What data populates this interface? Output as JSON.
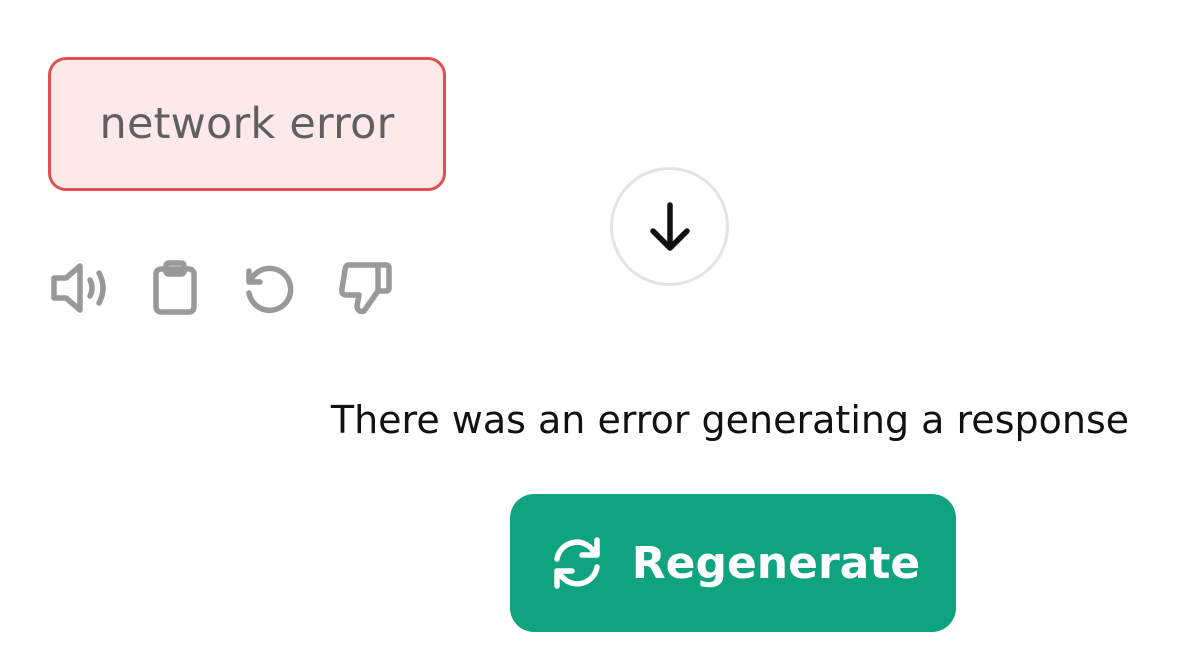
{
  "message": {
    "error_text": "network error"
  },
  "actions": [
    {
      "icon": "speaker-icon",
      "label": "Read aloud"
    },
    {
      "icon": "clipboard-icon",
      "label": "Copy"
    },
    {
      "icon": "retry-icon",
      "label": "Regenerate"
    },
    {
      "icon": "thumbs-down-icon",
      "label": "Bad response"
    }
  ],
  "scroll": {
    "icon": "arrow-down-icon"
  },
  "error_notice": {
    "text": "There was an error generating a response"
  },
  "regenerate_button": {
    "label": "Regenerate",
    "icon": "refresh-icon"
  },
  "colors": {
    "error_border": "#e05252",
    "error_background": "#fde9ea",
    "icon_gray": "#999999",
    "accent_green": "#10a37f"
  }
}
